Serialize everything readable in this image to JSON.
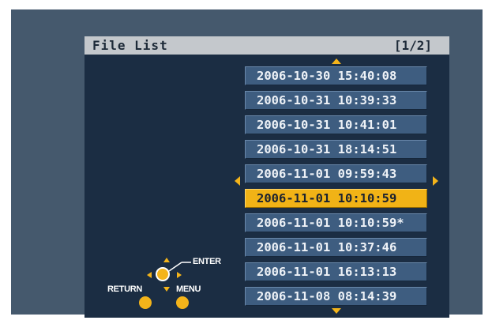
{
  "header": {
    "title": "File List",
    "page_indicator": "[1/2]"
  },
  "files": [
    {
      "label": "2006-10-30 15:40:08",
      "selected": false
    },
    {
      "label": "2006-10-31 10:39:33",
      "selected": false
    },
    {
      "label": "2006-10-31 10:41:01",
      "selected": false
    },
    {
      "label": "2006-10-31 18:14:51",
      "selected": false
    },
    {
      "label": "2006-11-01 09:59:43",
      "selected": false
    },
    {
      "label": "2006-11-01 10:10:59",
      "selected": true
    },
    {
      "label": "2006-11-01 10:10:59*",
      "selected": false
    },
    {
      "label": "2006-11-01 10:37:46",
      "selected": false
    },
    {
      "label": "2006-11-01 16:13:13",
      "selected": false
    },
    {
      "label": "2006-11-08 08:14:39",
      "selected": false
    }
  ],
  "guide": {
    "enter_label": "ENTER",
    "return_label": "RETURN",
    "menu_label": "MENU"
  },
  "colors": {
    "background_frame": "#45596d",
    "screen": "#1b2d43",
    "titlebar": "#c4c8cc",
    "item": "#3e5d80",
    "selected": "#f1b316",
    "accent": "#f4b41a"
  }
}
